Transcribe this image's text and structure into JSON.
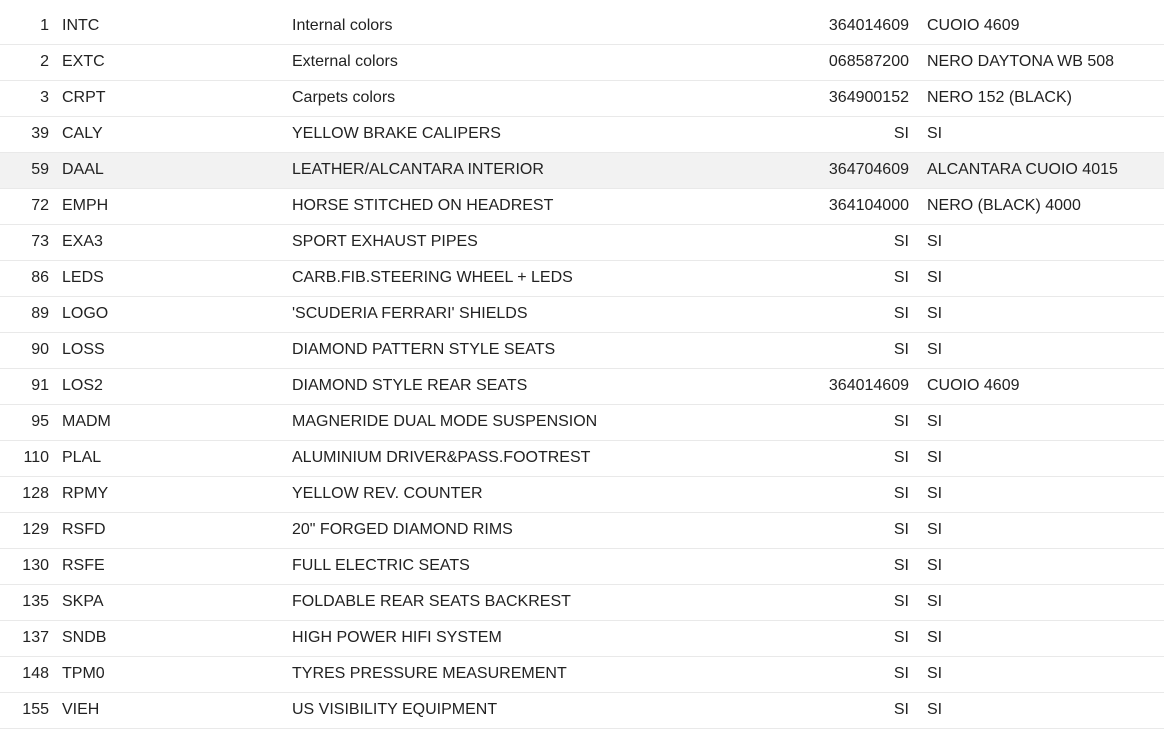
{
  "rows": [
    {
      "num": "1",
      "code": "INTC",
      "desc": "Internal colors",
      "val": "364014609",
      "name": "CUOIO 4609"
    },
    {
      "num": "2",
      "code": "EXTC",
      "desc": "External colors",
      "val": "068587200",
      "name": "NERO DAYTONA WB 508"
    },
    {
      "num": "3",
      "code": "CRPT",
      "desc": "Carpets colors",
      "val": "364900152",
      "name": "NERO 152 (BLACK)"
    },
    {
      "num": "39",
      "code": "CALY",
      "desc": "YELLOW BRAKE CALIPERS",
      "val": "SI",
      "name": "SI"
    },
    {
      "num": "59",
      "code": "DAAL",
      "desc": "LEATHER/ALCANTARA INTERIOR",
      "val": "364704609",
      "name": "ALCANTARA CUOIO 4015"
    },
    {
      "num": "72",
      "code": "EMPH",
      "desc": "HORSE STITCHED ON HEADREST",
      "val": "364104000",
      "name": "NERO (BLACK) 4000"
    },
    {
      "num": "73",
      "code": "EXA3",
      "desc": "SPORT EXHAUST PIPES",
      "val": "SI",
      "name": "SI"
    },
    {
      "num": "86",
      "code": "LEDS",
      "desc": "CARB.FIB.STEERING WHEEL + LEDS",
      "val": "SI",
      "name": "SI"
    },
    {
      "num": "89",
      "code": "LOGO",
      "desc": "'SCUDERIA FERRARI' SHIELDS",
      "val": "SI",
      "name": "SI"
    },
    {
      "num": "90",
      "code": "LOSS",
      "desc": "DIAMOND PATTERN STYLE SEATS",
      "val": "SI",
      "name": "SI"
    },
    {
      "num": "91",
      "code": "LOS2",
      "desc": "DIAMOND STYLE REAR SEATS",
      "val": "364014609",
      "name": "CUOIO 4609"
    },
    {
      "num": "95",
      "code": "MADM",
      "desc": "MAGNERIDE DUAL MODE SUSPENSION",
      "val": "SI",
      "name": "SI"
    },
    {
      "num": "110",
      "code": "PLAL",
      "desc": "ALUMINIUM DRIVER&PASS.FOOTREST",
      "val": "SI",
      "name": "SI"
    },
    {
      "num": "128",
      "code": "RPMY",
      "desc": "YELLOW REV. COUNTER",
      "val": "SI",
      "name": "SI"
    },
    {
      "num": "129",
      "code": "RSFD",
      "desc": "20\" FORGED DIAMOND RIMS",
      "val": "SI",
      "name": "SI"
    },
    {
      "num": "130",
      "code": "RSFE",
      "desc": "FULL ELECTRIC SEATS",
      "val": "SI",
      "name": "SI"
    },
    {
      "num": "135",
      "code": "SKPA",
      "desc": "FOLDABLE REAR SEATS BACKREST",
      "val": "SI",
      "name": "SI"
    },
    {
      "num": "137",
      "code": "SNDB",
      "desc": "HIGH POWER HIFI SYSTEM",
      "val": "SI",
      "name": "SI"
    },
    {
      "num": "148",
      "code": "TPM0",
      "desc": "TYRES PRESSURE MEASUREMENT",
      "val": "SI",
      "name": "SI"
    },
    {
      "num": "155",
      "code": "VIEH",
      "desc": "US VISIBILITY EQUIPMENT",
      "val": "SI",
      "name": "SI"
    }
  ]
}
